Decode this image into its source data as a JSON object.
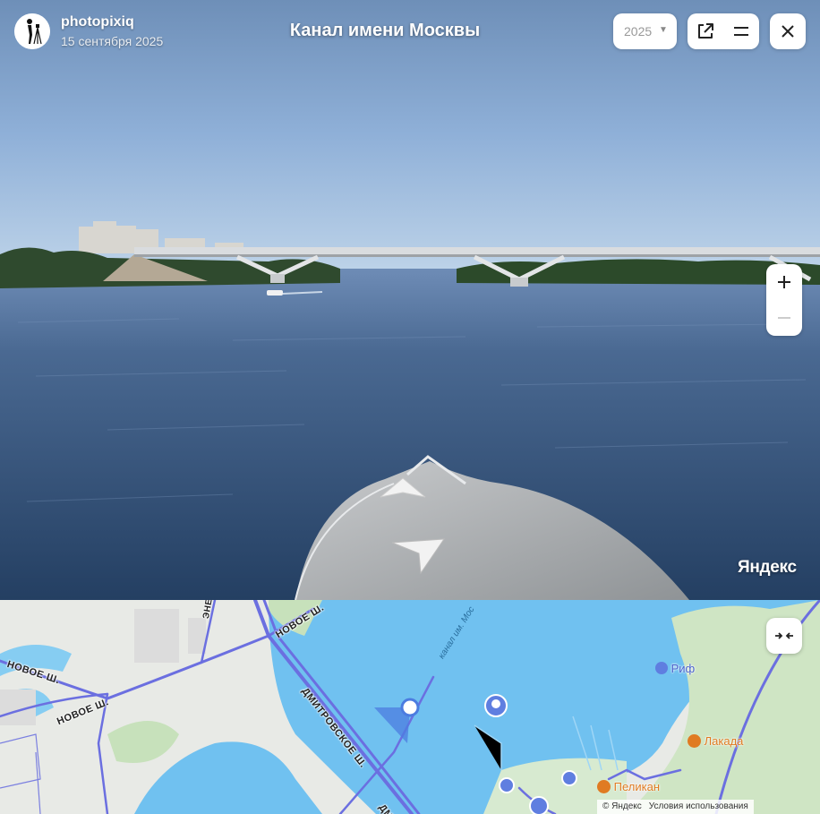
{
  "header": {
    "author": "photopixiq",
    "date": "15 сентября 2025",
    "title": "Канал имени Москвы",
    "year": "2025"
  },
  "panorama": {
    "brand": "Яндекс"
  },
  "map": {
    "road_labels": {
      "energetic": "ЭНЕРГЕТИЧ",
      "novoe_top": "НОВОЕ Ш.",
      "novoe_left": "НОВОЕ Ш.",
      "novoe_mid": "НОВОЕ Ш.",
      "dmitrovskoe": "ДМИТРОВСКОЕ Ш.",
      "dm_bottom": "ДМ",
      "canal": "канал им. Мос"
    },
    "pois": {
      "rif": "Риф",
      "lakada": "Лакада",
      "pelikan": "Пеликан"
    },
    "copyright": "© Яндекс",
    "terms": "Условия использования"
  },
  "colors": {
    "water": "#70c1f0",
    "road": "#6b6fe0",
    "poi_orange": "#e07b22",
    "poi_blue": "#5f7ee0"
  },
  "icons": {
    "external": "external-link-icon",
    "menu": "menu-icon",
    "close": "close-icon",
    "zoom_in": "plus-icon",
    "zoom_out": "minus-icon",
    "collapse": "collapse-arrows-icon"
  }
}
